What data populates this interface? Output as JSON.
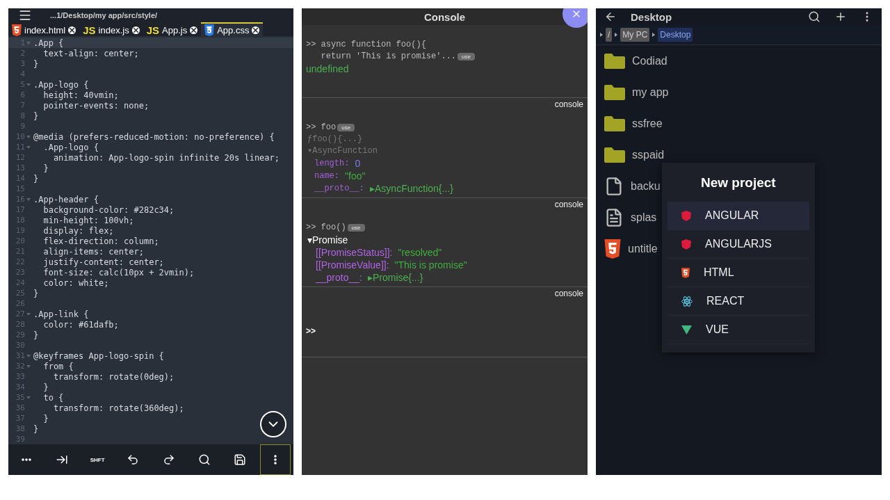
{
  "editor": {
    "path": "...1/Desktop/my app/src/style/",
    "tabs": [
      {
        "label": "index.html",
        "kind": "html",
        "selected": false
      },
      {
        "label": "index.js",
        "kind": "js",
        "icon_text": "JS",
        "selected": false
      },
      {
        "label": "App.js",
        "kind": "js",
        "icon_text": "JS",
        "selected": false
      },
      {
        "label": "App.css",
        "kind": "css",
        "selected": true
      }
    ],
    "lines": [
      {
        "n": "1",
        "text": ".App {",
        "fold": true,
        "current": true
      },
      {
        "n": "2",
        "text": "  text-align: center;",
        "fold": false,
        "current": false
      },
      {
        "n": "3",
        "text": "}",
        "fold": false,
        "current": false
      },
      {
        "n": "4",
        "fold": false,
        "current": false
      },
      {
        "n": "5",
        "text": ".App-logo {",
        "fold": true,
        "current": false
      },
      {
        "n": "6",
        "text": "  height: 40vmin;",
        "fold": false,
        "current": false
      },
      {
        "n": "7",
        "text": "  pointer-events: none;",
        "fold": false,
        "current": false
      },
      {
        "n": "8",
        "text": "}",
        "fold": false,
        "current": false
      },
      {
        "n": "9",
        "fold": false,
        "current": false
      },
      {
        "n": "10",
        "text": "@media (prefers-reduced-motion: no-preference) {",
        "fold": true,
        "current": false
      },
      {
        "n": "11",
        "text": "  .App-logo {",
        "fold": true,
        "current": false
      },
      {
        "n": "12",
        "text": "    animation: App-logo-spin infinite 20s linear;",
        "fold": false,
        "current": false
      },
      {
        "n": "13",
        "text": "  }",
        "fold": false,
        "current": false
      },
      {
        "n": "14",
        "text": "}",
        "fold": false,
        "current": false
      },
      {
        "n": "15",
        "fold": false,
        "current": false
      },
      {
        "n": "16",
        "text": ".App-header {",
        "fold": true,
        "current": false
      },
      {
        "n": "17",
        "text": "  background-color: #282c34;",
        "fold": false,
        "current": false
      },
      {
        "n": "18",
        "text": "  min-height: 100vh;",
        "fold": false,
        "current": false
      },
      {
        "n": "19",
        "text": "  display: flex;",
        "fold": false,
        "current": false
      },
      {
        "n": "20",
        "text": "  flex-direction: column;",
        "fold": false,
        "current": false
      },
      {
        "n": "21",
        "text": "  align-items: center;",
        "fold": false,
        "current": false
      },
      {
        "n": "22",
        "text": "  justify-content: center;",
        "fold": false,
        "current": false
      },
      {
        "n": "23",
        "text": "  font-size: calc(10px + 2vmin);",
        "fold": false,
        "current": false
      },
      {
        "n": "24",
        "text": "  color: white;",
        "fold": false,
        "current": false
      },
      {
        "n": "25",
        "text": "}",
        "fold": false,
        "current": false
      },
      {
        "n": "26",
        "fold": false,
        "current": false
      },
      {
        "n": "27",
        "text": ".App-link {",
        "fold": true,
        "current": false
      },
      {
        "n": "28",
        "text": "  color: #61dafb;",
        "fold": false,
        "current": false
      },
      {
        "n": "29",
        "text": "}",
        "fold": false,
        "current": false
      },
      {
        "n": "30",
        "fold": false,
        "current": false
      },
      {
        "n": "31",
        "text": "@keyframes App-logo-spin {",
        "fold": true,
        "current": false
      },
      {
        "n": "32",
        "text": "  from {",
        "fold": true,
        "current": false
      },
      {
        "n": "33",
        "text": "    transform: rotate(0deg);",
        "fold": false,
        "current": false
      },
      {
        "n": "34",
        "text": "  }",
        "fold": false,
        "current": false
      },
      {
        "n": "35",
        "text": "  to {",
        "fold": true,
        "current": false
      },
      {
        "n": "36",
        "text": "    transform: rotate(360deg);",
        "fold": false,
        "current": false
      },
      {
        "n": "37",
        "text": "  }",
        "fold": false,
        "current": false
      },
      {
        "n": "38",
        "text": "}",
        "fold": false,
        "current": false
      },
      {
        "n": "39",
        "fold": false,
        "current": false
      }
    ],
    "toolbar": [
      {
        "kind": "more",
        "selected": false
      },
      {
        "kind": "tab",
        "selected": false
      },
      {
        "kind": "shift",
        "label": "SHFT",
        "selected": false
      },
      {
        "kind": "undo",
        "selected": false
      },
      {
        "kind": "redo",
        "selected": false
      },
      {
        "kind": "search",
        "selected": false
      },
      {
        "kind": "save",
        "selected": false
      },
      {
        "kind": "menu",
        "selected": true
      }
    ]
  },
  "console": {
    "title": "Console",
    "entries": [
      {
        "input": [
          ">> async function foo(){",
          "   return 'This is promise'..."
        ],
        "badge": "use",
        "outputs": [
          {
            "kind": "result",
            "text": "undefined"
          }
        ]
      },
      {
        "source": "console",
        "input": [
          ">> foo"
        ],
        "badge": "use",
        "outputs": [
          {
            "kind": "dim",
            "text": "ƒfoo(){...}"
          },
          {
            "kind": "dim",
            "text": "▾AsyncFunction"
          },
          {
            "kind": "number_prop",
            "key": "length:",
            "value": "0"
          },
          {
            "kind": "string_prop",
            "key": "name:",
            "value": "\"foo\""
          },
          {
            "kind": "object_prop",
            "key": "__proto__:",
            "value": "▸AsyncFunction{...}"
          }
        ]
      },
      {
        "source": "console",
        "input": [
          ">> foo()"
        ],
        "badge": "use",
        "outputs": [
          {
            "kind": "plain",
            "text": "▾Promise"
          },
          {
            "kind": "sans_string_prop",
            "key": "[[PromiseStatus]]:",
            "value": "\"resolved\""
          },
          {
            "kind": "sans_string_prop",
            "key": "[[PromiseValue]]:",
            "value": "\"This is promise\""
          },
          {
            "kind": "sans_object_prop",
            "key": "__proto__:",
            "value": "▸Promise{...}"
          }
        ]
      },
      {
        "source": "console",
        "prompt": ">>"
      }
    ]
  },
  "files": {
    "title": "Desktop",
    "breadcrumb": [
      {
        "label": "/",
        "selected": false
      },
      {
        "label": "My PC",
        "selected": false
      },
      {
        "label": "Desktop",
        "selected": true
      }
    ],
    "items": [
      {
        "name": "Codiad",
        "kind": "folder"
      },
      {
        "name": "my app",
        "kind": "folder"
      },
      {
        "name": "ssfree",
        "kind": "folder"
      },
      {
        "name": "sspaid",
        "kind": "folder"
      },
      {
        "name": "backu",
        "kind": "file"
      },
      {
        "name": "splas",
        "kind": "doc"
      },
      {
        "name": "untitle",
        "kind": "html"
      }
    ],
    "dialog": {
      "title": "New project",
      "options": [
        {
          "label": "ANGULAR",
          "kind": "angular",
          "selected": true
        },
        {
          "label": "ANGULARJS",
          "kind": "angular",
          "selected": false
        },
        {
          "label": "HTML",
          "kind": "html",
          "selected": false
        },
        {
          "label": "REACT",
          "kind": "react",
          "selected": false
        },
        {
          "label": "VUE",
          "kind": "vue",
          "selected": false
        }
      ]
    }
  }
}
